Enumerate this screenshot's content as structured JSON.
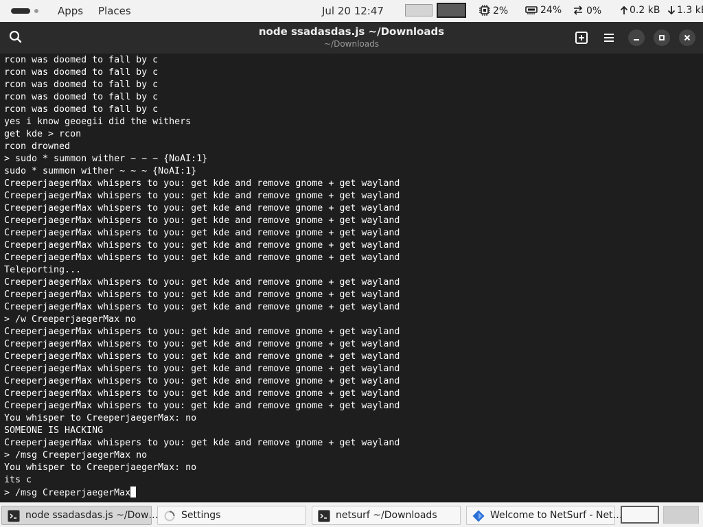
{
  "panel": {
    "apps_label": "Apps",
    "places_label": "Places",
    "clock": "Jul 20  12:47",
    "cpu": "2%",
    "memory": "24%",
    "swap": "0%",
    "net_up": "0.2 kB",
    "net_down": "1.3 kB"
  },
  "window": {
    "title": "node ssadasdas.js ~/Downloads",
    "subtitle": "~/Downloads"
  },
  "terminal": {
    "lines": [
      "rcon was doomed to fall by c",
      "rcon was doomed to fall by c",
      "rcon was doomed to fall by c",
      "rcon was doomed to fall by c",
      "rcon was doomed to fall by c",
      "yes i know geoegii did the withers",
      "get kde > rcon",
      "rcon drowned",
      "> sudo * summon wither ~ ~ ~ {NoAI:1}",
      "sudo * summon wither ~ ~ ~ {NoAI:1}",
      "CreeperjaegerMax whispers to you: get kde and remove gnome + get wayland",
      "CreeperjaegerMax whispers to you: get kde and remove gnome + get wayland",
      "CreeperjaegerMax whispers to you: get kde and remove gnome + get wayland",
      "CreeperjaegerMax whispers to you: get kde and remove gnome + get wayland",
      "CreeperjaegerMax whispers to you: get kde and remove gnome + get wayland",
      "CreeperjaegerMax whispers to you: get kde and remove gnome + get wayland",
      "CreeperjaegerMax whispers to you: get kde and remove gnome + get wayland",
      "Teleporting...",
      "CreeperjaegerMax whispers to you: get kde and remove gnome + get wayland",
      "CreeperjaegerMax whispers to you: get kde and remove gnome + get wayland",
      "CreeperjaegerMax whispers to you: get kde and remove gnome + get wayland",
      "> /w CreeperjaegerMax no",
      "CreeperjaegerMax whispers to you: get kde and remove gnome + get wayland",
      "CreeperjaegerMax whispers to you: get kde and remove gnome + get wayland",
      "CreeperjaegerMax whispers to you: get kde and remove gnome + get wayland",
      "CreeperjaegerMax whispers to you: get kde and remove gnome + get wayland",
      "CreeperjaegerMax whispers to you: get kde and remove gnome + get wayland",
      "CreeperjaegerMax whispers to you: get kde and remove gnome + get wayland",
      "CreeperjaegerMax whispers to you: get kde and remove gnome + get wayland",
      "You whisper to CreeperjaegerMax: no",
      "SOMEONE IS HACKING",
      "CreeperjaegerMax whispers to you: get kde and remove gnome + get wayland",
      "> /msg CreeperjaegerMax no",
      "You whisper to CreeperjaegerMax: no",
      "its c"
    ],
    "prompt_input": "> /msg CreeperjaegerMax"
  },
  "taskbar": {
    "items": [
      {
        "label": "node ssadasdas.js ~/Dow…",
        "icon": "terminal-icon",
        "active": true
      },
      {
        "label": "Settings",
        "icon": "spinner-icon",
        "active": false
      },
      {
        "label": "netsurf ~/Downloads",
        "icon": "terminal-icon",
        "active": false
      },
      {
        "label": "Welcome to NetSurf - Net…",
        "icon": "netsurf-icon",
        "active": false
      }
    ]
  },
  "colors": {
    "terminal_bg": "#1e1e1e",
    "titlebar_bg": "#2b2b2b",
    "panel_bg": "#f2f2f2",
    "netsurf_blue": "#2a6fd6"
  }
}
